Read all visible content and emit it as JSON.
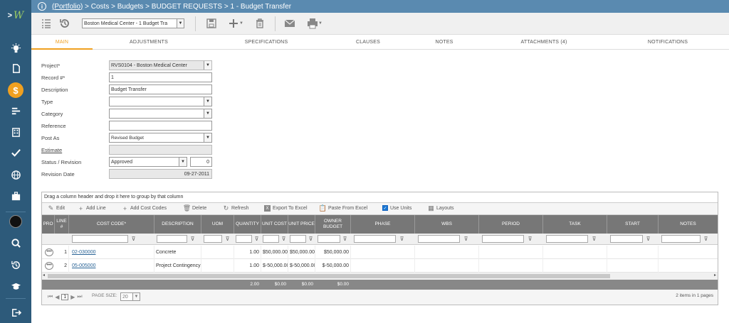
{
  "app": {
    "logo_left": ">",
    "logo_right": "W"
  },
  "sidebar": {
    "active_icon": "$"
  },
  "breadcrumb": {
    "portfolio": "(Portfolio)",
    "rest": " > Costs > Budgets > BUDGET REQUESTS > 1 - Budget Transfer"
  },
  "toolbar": {
    "record_select": "Boston Medical Center - 1 Budget Tra"
  },
  "tabs": [
    "MAIN",
    "ADJUSTMENTS",
    "SPECIFICATIONS",
    "CLAUSES",
    "NOTES",
    "ATTACHMENTS (4)",
    "NOTIFICATIONS"
  ],
  "form": {
    "project_label": "Project*",
    "project_value": "RVS0104 - Boston Medical Center",
    "record_label": "Record #*",
    "record_value": "1",
    "description_label": "Description",
    "description_value": "Budget Transfer",
    "type_label": "Type",
    "category_label": "Category",
    "reference_label": "Reference",
    "postas_label": "Post As",
    "postas_value": "Revised Budget",
    "estimate_label": "Estimate",
    "status_label": "Status / Revision",
    "status_value": "Approved",
    "revision_value": "0",
    "revdate_label": "Revision Date",
    "revdate_value": "09-27-2011"
  },
  "grid": {
    "group_hint": "Drag a column header and drop it here to group by that column",
    "toolbar": {
      "edit": "Edit",
      "add_line": "Add Line",
      "add_cost_codes": "Add Cost Codes",
      "delete": "Delete",
      "refresh": "Refresh",
      "export": "Export To Excel",
      "paste": "Paste From Excel",
      "use_units": "Use Units",
      "layouts": "Layouts"
    },
    "columns": [
      "PRO",
      "LINE #",
      "COST CODE*",
      "DESCRIPTION",
      "UOM",
      "QUANTITY",
      "UNIT COST",
      "UNIT PRICE",
      "OWNER BUDGET",
      "PHASE",
      "WBS",
      "PERIOD",
      "TASK",
      "START",
      "NOTES"
    ],
    "rows": [
      {
        "line": "1",
        "code": "02-030000",
        "desc": "Concrete",
        "uom": "",
        "qty": "1.00",
        "ucost": "$50,000.00",
        "uprice": "$50,000.00",
        "owner": "$50,000.00"
      },
      {
        "line": "2",
        "code": "05-005000",
        "desc": "Project Contingency",
        "uom": "",
        "qty": "1.00",
        "ucost": "$-50,000.00",
        "uprice": "$-50,000.00",
        "owner": "$-50,000.00"
      }
    ],
    "totals": {
      "qty": "2.00",
      "ucost": "$0.00",
      "uprice": "$0.00",
      "owner": "$0.00"
    },
    "pager": {
      "page": "1",
      "page_size_label": "PAGE SIZE:",
      "page_size": "20",
      "summary": "2 items in 1 pages"
    }
  }
}
